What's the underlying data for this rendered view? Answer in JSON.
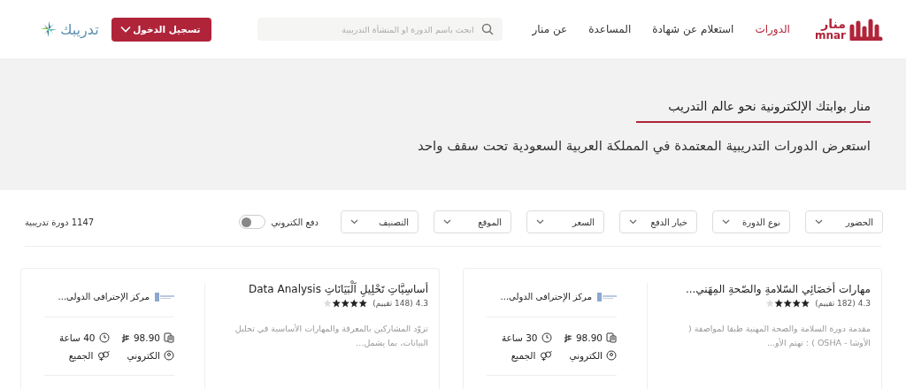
{
  "header": {
    "logo": {
      "arabic": "منار",
      "latin": "mnar"
    },
    "nav": [
      {
        "label": "الدورات",
        "selected": true
      },
      {
        "label": "استعلام عن شهادة",
        "selected": false
      },
      {
        "label": "المساعدة",
        "selected": false
      },
      {
        "label": "عن منار",
        "selected": false
      }
    ],
    "search": {
      "placeholder": "ابحث باسم الدورة او المنشأة التدريبية"
    },
    "login_button": "تسجيل الدخول",
    "partner_logo": "تدريبك"
  },
  "hero": {
    "title": "منار بوابتك الإلكترونية نحو عالم التدريب",
    "subtitle": "استعرض الدورات التدريبية المعتمدة في المملكة العربية السعودية تحت سقف واحد"
  },
  "filters": [
    {
      "label": "الحضور"
    },
    {
      "label": "نوع الدورة"
    },
    {
      "label": "خيار الدفع"
    },
    {
      "label": "السعر"
    },
    {
      "label": "الموقع"
    },
    {
      "label": "التصنيف"
    }
  ],
  "e_payment_toggle": {
    "label": "دفع الكتروني",
    "on": false
  },
  "course_count": "1147 دورة تدريبية",
  "courses": [
    {
      "title": "مهارات أخصَائِي السّلامةِ والصّحةِ المِهَني...",
      "rating": "4.3",
      "reviews": "(182 تقييم)",
      "stars": 4,
      "description": "مقدمة دورة السلامة والصحة المهنية طبقا لمواصفة ( الأوشا - OSHA ) : تهتم الأو...",
      "provider": "مركز الإحترافى الدولى...",
      "price": "98.90",
      "hours": "30 ساعة",
      "mode": "الكتروني",
      "audience": "الجميع"
    },
    {
      "title": "أساسِيَّاتِ تَحْلِيلِ اَلْبَيَانَاتِ Data Analysis",
      "rating": "4.3",
      "reviews": "(148 تقييم)",
      "stars": 4,
      "description": "تزوّد المشاركين بالمعرفة والمهارات الأساسية في تحليل البيانات، بما يشمل...",
      "provider": "مركز الإحترافى الدولى...",
      "price": "98.90",
      "hours": "40 ساعة",
      "mode": "الكتروني",
      "audience": "الجميع"
    }
  ]
}
